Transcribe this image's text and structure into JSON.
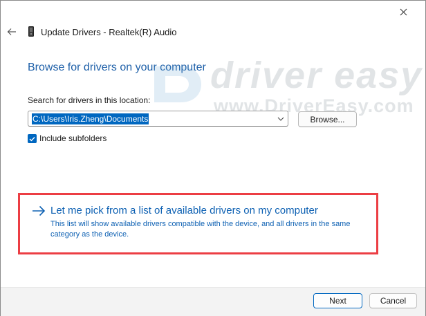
{
  "window": {
    "title": "Update Drivers - Realtek(R) Audio",
    "close_icon": "close-icon",
    "back_icon": "back-arrow-icon",
    "device_icon": "audio-device-icon"
  },
  "page": {
    "heading": "Browse for drivers on your computer",
    "search_label": "Search for drivers in this location:",
    "path_value": "C:\\Users\\Iris.Zheng\\Documents",
    "browse_label": "Browse...",
    "include_subfolders_label": "Include subfolders",
    "include_subfolders_checked": true
  },
  "pick": {
    "title": "Let me pick from a list of available drivers on my computer",
    "description": "This list will show available drivers compatible with the device, and all drivers in the same category as the device.",
    "icon": "right-arrow-icon"
  },
  "watermark": {
    "logo_text": "driver easy",
    "url_text": "www.DriverEasy.com"
  },
  "footer": {
    "next_label": "Next",
    "cancel_label": "Cancel"
  },
  "colors": {
    "accent": "#0067c0",
    "link": "#0e61b3",
    "heading": "#1d5fa8",
    "highlight": "#ec3e44"
  }
}
